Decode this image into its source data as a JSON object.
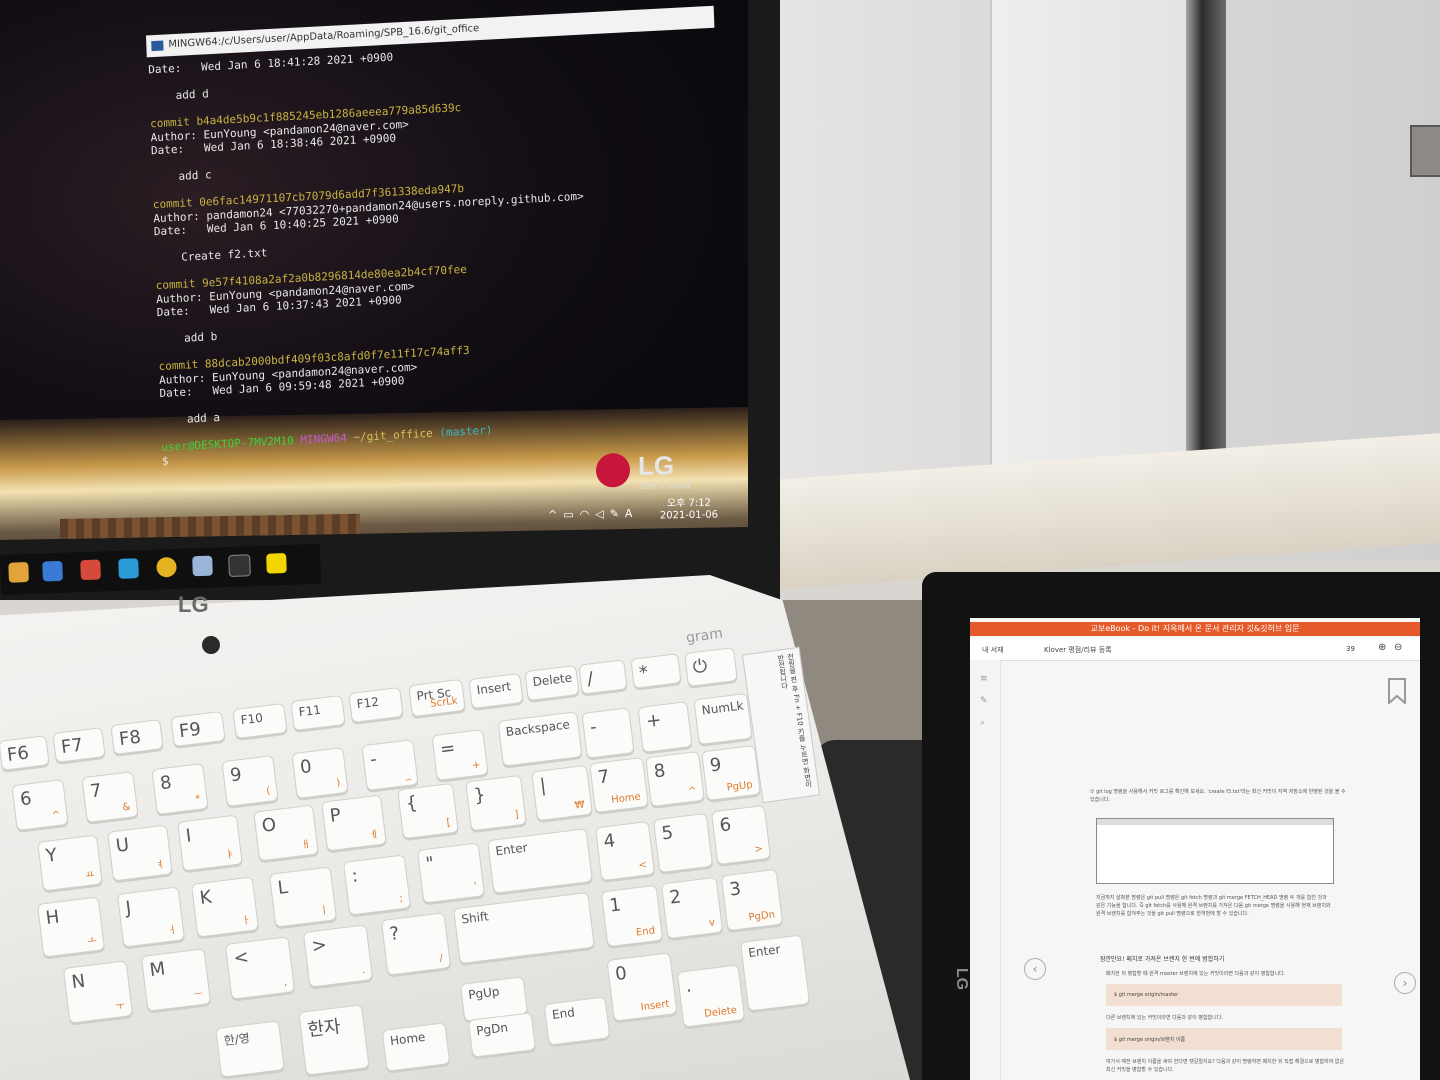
{
  "terminal": {
    "title": "MINGW64:/c/Users/user/AppData/Roaming/SPB_16.6/git_office",
    "lines": [
      {
        "kind": "text",
        "text": "Date:   Wed Jan 6 18:41:28 2021 +0900"
      },
      {
        "kind": "blank",
        "text": ""
      },
      {
        "kind": "text",
        "text": "    add d"
      },
      {
        "kind": "blank",
        "text": ""
      },
      {
        "kind": "commit",
        "text": "commit b4a4de5b9c1f885245eb1286aeeea779a85d639c"
      },
      {
        "kind": "text",
        "text": "Author: EunYoung <pandamon24@naver.com>"
      },
      {
        "kind": "text",
        "text": "Date:   Wed Jan 6 18:38:46 2021 +0900"
      },
      {
        "kind": "blank",
        "text": ""
      },
      {
        "kind": "text",
        "text": "    add c"
      },
      {
        "kind": "blank",
        "text": ""
      },
      {
        "kind": "commit",
        "text": "commit 0e6fac14971107cb7079d6add7f361338eda947b"
      },
      {
        "kind": "text",
        "text": "Author: pandamon24 <77032270+pandamon24@users.noreply.github.com>"
      },
      {
        "kind": "text",
        "text": "Date:   Wed Jan 6 10:40:25 2021 +0900"
      },
      {
        "kind": "blank",
        "text": ""
      },
      {
        "kind": "text",
        "text": "    Create f2.txt"
      },
      {
        "kind": "blank",
        "text": ""
      },
      {
        "kind": "commit",
        "text": "commit 9e57f4108a2af2a0b8296814de80ea2b4cf70fee"
      },
      {
        "kind": "text",
        "text": "Author: EunYoung <pandamon24@naver.com>"
      },
      {
        "kind": "text",
        "text": "Date:   Wed Jan 6 10:37:43 2021 +0900"
      },
      {
        "kind": "blank",
        "text": ""
      },
      {
        "kind": "text",
        "text": "    add b"
      },
      {
        "kind": "blank",
        "text": ""
      },
      {
        "kind": "commit",
        "text": "commit 88dcab2000bdf409f03c8afd0f7e11f17c74aff3"
      },
      {
        "kind": "text",
        "text": "Author: EunYoung <pandamon24@naver.com>"
      },
      {
        "kind": "text",
        "text": "Date:   Wed Jan 6 09:59:48 2021 +0900"
      },
      {
        "kind": "blank",
        "text": ""
      },
      {
        "kind": "text",
        "text": "    add a"
      },
      {
        "kind": "blank",
        "text": ""
      }
    ],
    "prompt": {
      "user": "user@DESKTOP-7MV2M10",
      "mingw": "MINGW64",
      "path": "~/git_office",
      "branch": "(master)",
      "symbol": "$"
    }
  },
  "wallpaper_logo": {
    "brand": "LG",
    "tagline": "Life's Good"
  },
  "systray": {
    "time": "오후 7:12",
    "date": "2021-01-06",
    "input": "A"
  },
  "laptop": {
    "brand": "LG",
    "model": "gram",
    "sticker": "전원을 켠 후 Fn + F10 키를 누르면 화면이 반전됩니다"
  },
  "keys": [
    {
      "id": "key-f6",
      "main": "F6"
    },
    {
      "id": "key-f7",
      "main": "F7"
    },
    {
      "id": "key-f8",
      "main": "F8"
    },
    {
      "id": "key-f9",
      "main": "F9"
    },
    {
      "id": "key-f10",
      "main": "F10"
    },
    {
      "id": "key-f11",
      "main": "F11"
    },
    {
      "id": "key-f12",
      "main": "F12"
    },
    {
      "id": "key-prtsc",
      "main": "Prt Sc",
      "sub": "ScrLk"
    },
    {
      "id": "key-insert",
      "main": "Insert"
    },
    {
      "id": "key-delete",
      "main": "Delete"
    },
    {
      "id": "key-slash-np",
      "main": "/"
    },
    {
      "id": "key-star-np",
      "main": "*"
    },
    {
      "id": "key-power",
      "main": "⏻"
    },
    {
      "id": "key-6",
      "main": "6",
      "sub": "^"
    },
    {
      "id": "key-7",
      "main": "7",
      "sub": "&"
    },
    {
      "id": "key-8",
      "main": "8",
      "sub": "*"
    },
    {
      "id": "key-9",
      "main": "9",
      "sub": "("
    },
    {
      "id": "key-0",
      "main": "0",
      "sub": ")"
    },
    {
      "id": "key-minus",
      "main": "-",
      "sub": "_"
    },
    {
      "id": "key-equals",
      "main": "=",
      "sub": "+"
    },
    {
      "id": "key-backspace",
      "main": "Backspace"
    },
    {
      "id": "key-minus-np",
      "main": "-"
    },
    {
      "id": "key-plus-np",
      "main": "+"
    },
    {
      "id": "key-numlk",
      "main": "NumLk"
    },
    {
      "id": "key-y",
      "main": "Y",
      "sub": "ㅛ"
    },
    {
      "id": "key-u",
      "main": "U",
      "sub": "ㅕ"
    },
    {
      "id": "key-i",
      "main": "I",
      "sub": "ㅑ"
    },
    {
      "id": "key-o",
      "main": "O",
      "sub": "ㅐ"
    },
    {
      "id": "key-p",
      "main": "P",
      "sub": "ㅔ"
    },
    {
      "id": "key-bracket-l",
      "main": "{",
      "sub": "["
    },
    {
      "id": "key-bracket-r",
      "main": "}",
      "sub": "]"
    },
    {
      "id": "key-won",
      "main": "|",
      "sub": "₩"
    },
    {
      "id": "key-7-np",
      "main": "7",
      "sub": "Home"
    },
    {
      "id": "key-8-np",
      "main": "8",
      "sub": "^"
    },
    {
      "id": "key-9-np",
      "main": "9",
      "sub": "PgUp"
    },
    {
      "id": "key-h",
      "main": "H",
      "sub": "ㅗ"
    },
    {
      "id": "key-j",
      "main": "J",
      "sub": "ㅓ"
    },
    {
      "id": "key-k",
      "main": "K",
      "sub": "ㅏ"
    },
    {
      "id": "key-l",
      "main": "L",
      "sub": "ㅣ"
    },
    {
      "id": "key-semicolon",
      "main": ":",
      "sub": ";"
    },
    {
      "id": "key-quote",
      "main": "\"",
      "sub": "'"
    },
    {
      "id": "key-enter",
      "main": "Enter"
    },
    {
      "id": "key-4-np",
      "main": "4",
      "sub": "<"
    },
    {
      "id": "key-5-np",
      "main": "5"
    },
    {
      "id": "key-6-np",
      "main": "6",
      "sub": ">"
    },
    {
      "id": "key-n",
      "main": "N",
      "sub": "ㅜ"
    },
    {
      "id": "key-m",
      "main": "M",
      "sub": "ㅡ"
    },
    {
      "id": "key-comma",
      "main": "<",
      "sub": ","
    },
    {
      "id": "key-period",
      "main": ">",
      "sub": "."
    },
    {
      "id": "key-question",
      "main": "?",
      "sub": "/"
    },
    {
      "id": "key-shift-r",
      "main": "Shift"
    },
    {
      "id": "key-1-np",
      "main": "1",
      "sub": "End"
    },
    {
      "id": "key-2-np",
      "main": "2",
      "sub": "v"
    },
    {
      "id": "key-3-np",
      "main": "3",
      "sub": "PgDn"
    },
    {
      "id": "key-hanyeong",
      "main": "한/영"
    },
    {
      "id": "key-hanja",
      "main": "한자"
    },
    {
      "id": "key-home",
      "main": "Home"
    },
    {
      "id": "key-pgup",
      "main": "PgUp"
    },
    {
      "id": "key-pgdn",
      "main": "PgDn"
    },
    {
      "id": "key-end",
      "main": "End"
    },
    {
      "id": "key-0-np",
      "main": "0",
      "sub": "Insert"
    },
    {
      "id": "key-dot-np",
      "main": ".",
      "sub": "Delete"
    },
    {
      "id": "key-enter-np",
      "main": "Enter"
    }
  ],
  "tablet": {
    "title": "교보eBook - Do it! 지옥에서 온 문서 관리자 깃&깃허브 입문",
    "toolbar": {
      "library": "내 서재",
      "review": "Klover 평점/리뷰 등록",
      "page": "39"
    },
    "body_text": "① git log 명령을 사용해서 커밋 로그를 확인해 보세요. 'create f3.txt'라는 최신 커밋이 지역 저장소에 반영된 것을 볼 수 있습니다.",
    "body_text2": "지금까지 살펴본 명령은 git pull 명령은 git fetch 명령과 git merge FETCH_HEAD 명령 두 개를 합친 것과 같은 기능을 합니다. 즉 git fetch를 사용해 원격 브랜치를 가져온 다음 git merge 명령을 사용해 현재 브랜치와 원격 브랜치를 합쳐주는 것을 git pull 명령으로 한꺼번에 할 수 있습니다.",
    "heading": "잠깐만요! 패치로 가져온 브랜치 한 번에 병합하기",
    "note": "패치한 뒤 병합할 때 원격 master 브랜치에 있는 커밋이라면 다음과 같이 병합합니다.",
    "code1": "$ git merge origin/master",
    "note2": "다른 브랜치에 있는 커밋이라면 다음과 같이 병합합니다.",
    "code2": "$ git merge origin/브랜치 이름",
    "note3": "여기서 예전 브랜치 이름을 써야 한다면 헷갈릴지요? 다음과 같이 명령하면 패치한 뒤 직접 해결으로 병합하여 없은 최신 커밋을 병합할 수 있습니다.",
    "brand": "LG"
  },
  "colors": {
    "lg_red": "#c7153c",
    "tablet_title": "#e65a2a",
    "commit": "#c8b341",
    "prompt_green": "#3fcf3f",
    "prompt_purple": "#c35bd0",
    "prompt_cyan": "#34b7c9"
  }
}
